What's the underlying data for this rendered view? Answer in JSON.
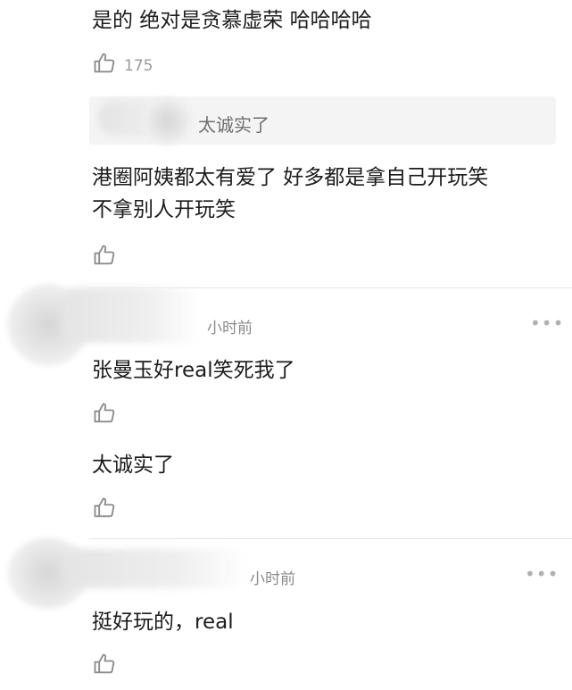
{
  "top_comment": {
    "text": "是的 绝对是贪慕虚荣 哈哈哈哈",
    "likes": "175"
  },
  "reply_1": {
    "quoted_text": "太诚实了",
    "text_line1": "港圈阿姨都太有爱了 好多都是拿自己开玩笑",
    "text_line2": "不拿别人开玩笑"
  },
  "comment_2": {
    "time": "小时前",
    "more": "•••",
    "text": "张曼玉好real笑死我了"
  },
  "reply_2": {
    "text": "太诚实了"
  },
  "comment_3": {
    "time": "小时前",
    "more": "•••",
    "text": "挺好玩的，real"
  }
}
